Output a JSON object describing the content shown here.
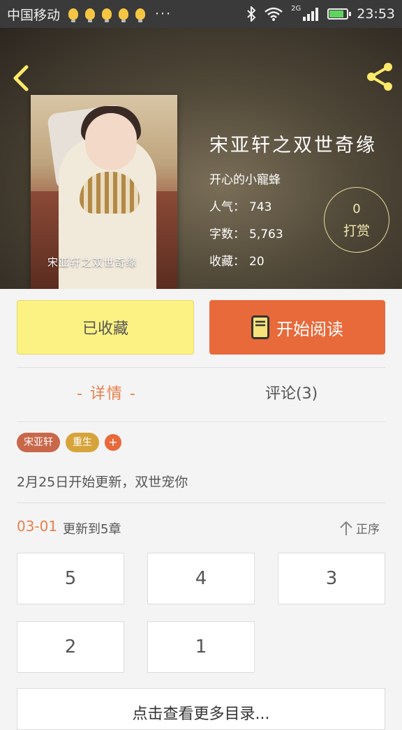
{
  "status_bar": {
    "carrier": "中国移动",
    "dots": "···",
    "network": "2G",
    "time": "23:53",
    "battery_level": 0.75
  },
  "header": {
    "book_title": "宋亚轩之双世奇缘",
    "author": "开心的小寵蜂",
    "cover_caption": "宋亚轩之双世奇缘",
    "stats": [
      {
        "label": "人气：",
        "value": "743"
      },
      {
        "label": "字数：",
        "value": "5,763"
      },
      {
        "label": "收藏：",
        "value": "20"
      }
    ],
    "tip": {
      "count": "0",
      "label": "打赏"
    }
  },
  "actions": {
    "collected_label": "已收藏",
    "read_label": "开始阅读"
  },
  "tabs": {
    "detail": "- 详情 -",
    "comments": "评论(3)"
  },
  "tags": [
    {
      "label": "宋亚轩",
      "color": "#c8674a"
    },
    {
      "label": "重生",
      "color": "#d6a43a"
    },
    {
      "label": "+",
      "color": "#e8693a"
    }
  ],
  "description": "2月25日开始更新，双世宠你",
  "update": {
    "date": "03-01",
    "text": "更新到5章",
    "sort_label": "正序"
  },
  "chapters": [
    "5",
    "4",
    "3",
    "2",
    "1"
  ],
  "more_catalog": "点击查看更多目录..."
}
